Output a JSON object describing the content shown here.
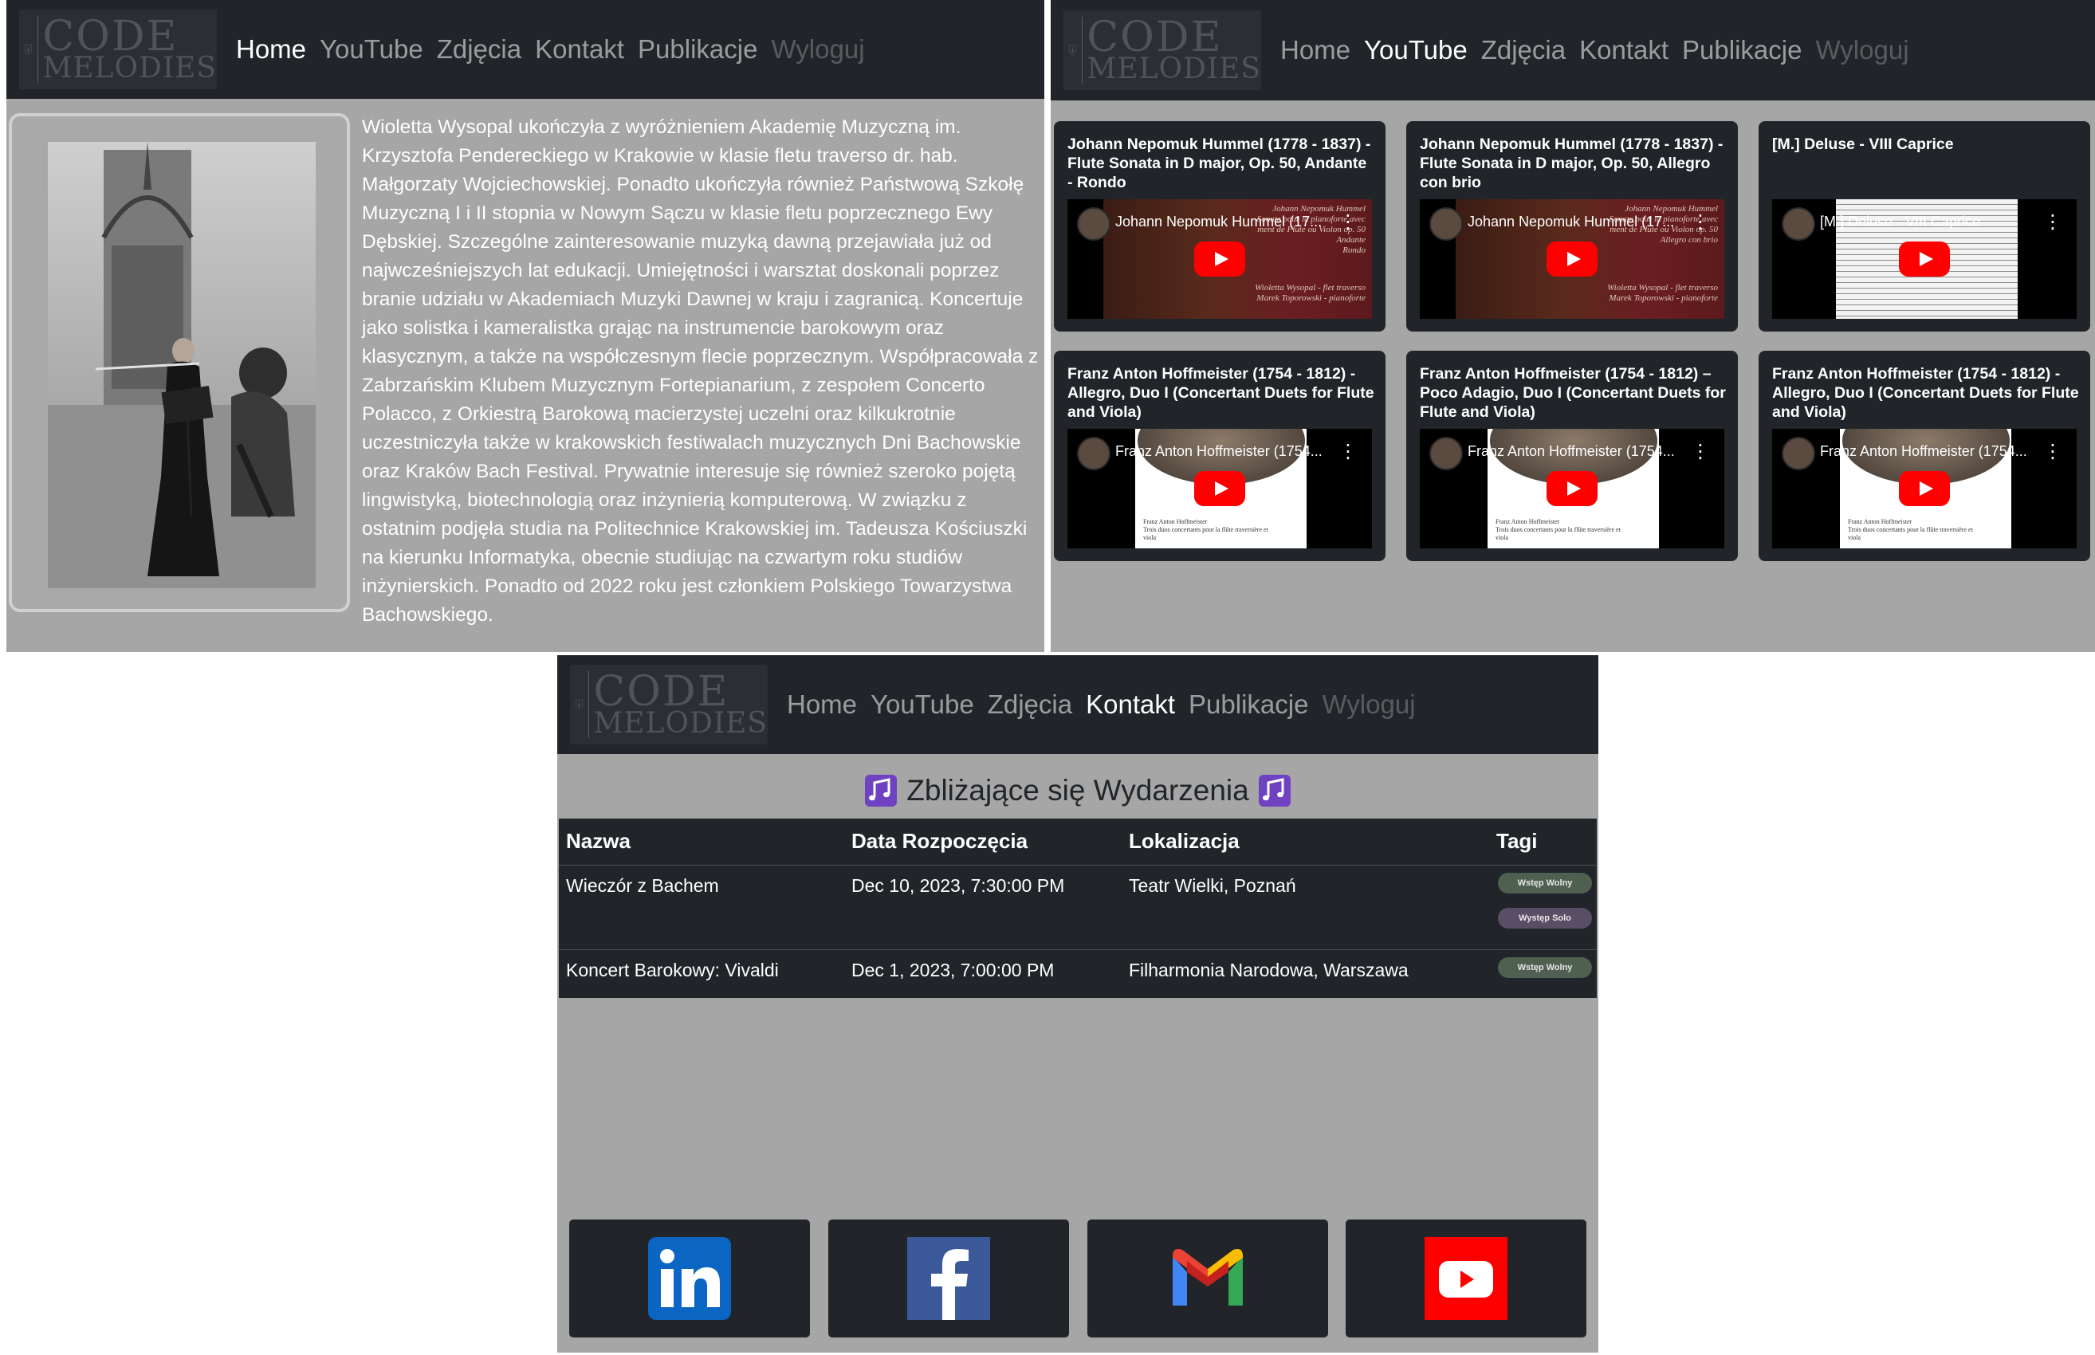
{
  "nav": {
    "logo_line1": "CODE",
    "logo_line2": "MELODIES",
    "items": [
      "Home",
      "YouTube",
      "Zdjęcia",
      "Kontakt",
      "Publikacje",
      "Wyloguj"
    ]
  },
  "about": {
    "bio": "Wioletta Wysopal ukończyła z wyróżnieniem Akademię Muzyczną im. Krzysztofa Pendereckiego w Krakowie w klasie fletu traverso dr. hab. Małgorzaty Wojciechowskiej. Ponadto ukończyła również Państwową Szkołę Muzyczną I i II stopnia w Nowym Sączu w klasie fletu poprzecznego Ewy Dębskiej. Szczególne zainteresowanie muzyką dawną przejawiała już od najwcześniejszych lat edukacji. Umiejętności i warsztat doskonali poprzez branie udziału w Akademiach Muzyki Dawnej w kraju i zagranicą. Koncertuje jako solistka i kameralistka grając na instrumencie barokowym oraz klasycznym, a także na współczesnym flecie poprzecznym. Współpracowała z Zabrzańskim Klubem Muzycznym Fortepianarium, z zespołem Concerto Polacco, z Orkiestrą Barokową macierzystej uczelni oraz kilkukrotnie uczestniczyła także w krakowskich festiwalach muzycznych Dni Bachowskie oraz Kraków Bach Festival. Prywatnie interesuje się również szeroko pojętą lingwistyką, biotechnologią oraz inżynierią komputerową. W związku z ostatnim podjęła studia na Politechnice Krakowskiej im. Tadeusza Kościuszki na kierunku Informatyka, obecnie studiując na czwartym roku studiów inżynierskich. Ponadto od 2022 roku jest członkiem Polskiego Towarzystwa Bachowskiego."
  },
  "videos": [
    {
      "title": "Johann Nepomuk Hummel (1778 - 1837) - Flute Sonata in D major, Op. 50, Andante - Rondo",
      "video_title": "Johann Nepomuk Hummel (17...",
      "thumb": "painting",
      "overlay": [
        "Johann Nepomuk Hummel",
        "Sonate pour la pianoforte avec",
        "ment de Flute ou Violon op. 50",
        "Andante",
        "Rondo",
        "Wioletta Wysopal - flet traverso",
        "Marek Toporowski - pianoforte"
      ]
    },
    {
      "title": "Johann Nepomuk Hummel (1778 - 1837) - Flute Sonata in D major, Op. 50, Allegro con brio",
      "video_title": "Johann Nepomuk Hummel (17...",
      "thumb": "painting",
      "overlay": [
        "Johann Nepomuk Hummel",
        "Sonate pour la pianoforte avec",
        "ment de Flute ou Violon op. 50",
        "Allegro con brio",
        "Wioletta Wysopal - flet traverso",
        "Marek Toporowski - pianoforte"
      ]
    },
    {
      "title": "[M.] Deluse - VIII Caprice",
      "video_title": "[M.] Deluse - VIII Caprice",
      "thumb": "sheet",
      "overlay": []
    },
    {
      "title": "Franz Anton Hoffmeister (1754 - 1812) - Allegro, Duo I (Concertant Duets for Flute and Viola)",
      "video_title": "Franz Anton Hoffmeister (1754...",
      "thumb": "paper",
      "overlay": [
        "Franz Anton Hoffmeister",
        "Trois duos concertants pour la flûte traversière et",
        "viola"
      ]
    },
    {
      "title": "Franz Anton Hoffmeister (1754 - 1812) – Poco Adagio, Duo I (Concertant Duets for Flute and Viola)",
      "video_title": "Franz Anton Hoffmeister (1754...",
      "thumb": "paper",
      "overlay": [
        "Franz Anton Hoffmeister",
        "Trois duos concertants pour la flûte traversière et",
        "viola"
      ]
    },
    {
      "title": "Franz Anton Hoffmeister (1754 - 1812) - Allegro, Duo I (Concertant Duets for Flute and Viola)",
      "video_title": "Franz Anton Hoffmeister (1754...",
      "thumb": "paper",
      "overlay": [
        "Franz Anton Hoffmeister",
        "Trois duos concertants pour la flûte traversière et",
        "viola"
      ]
    }
  ],
  "events": {
    "title": "Zbliżające się Wydarzenia",
    "columns": [
      "Nazwa",
      "Data Rozpoczęcia",
      "Lokalizacja",
      "Tagi"
    ],
    "rows": [
      {
        "name": "Wieczór z Bachem",
        "date": "Dec 10, 2023, 7:30:00 PM",
        "location": "Teatr Wielki, Poznań",
        "tags": [
          "Wstęp Wolny",
          "Występ Solo"
        ]
      },
      {
        "name": "Koncert Barokowy: Vivaldi",
        "date": "Dec 1, 2023, 7:00:00 PM",
        "location": "Filharmonia Narodowa, Warszawa",
        "tags": [
          "Wstęp Wolny"
        ]
      }
    ]
  },
  "social": [
    "linkedin-icon",
    "facebook-icon",
    "gmail-icon",
    "youtube-icon"
  ],
  "colors": {
    "navbar": "#212529",
    "page_bg": "#a6a6a6",
    "card_bg": "#212529",
    "tag_green": "#4f5f50",
    "tag_purple": "#5a4e66",
    "youtube_red": "#ff0000",
    "music_icon": "#6f42c1"
  }
}
